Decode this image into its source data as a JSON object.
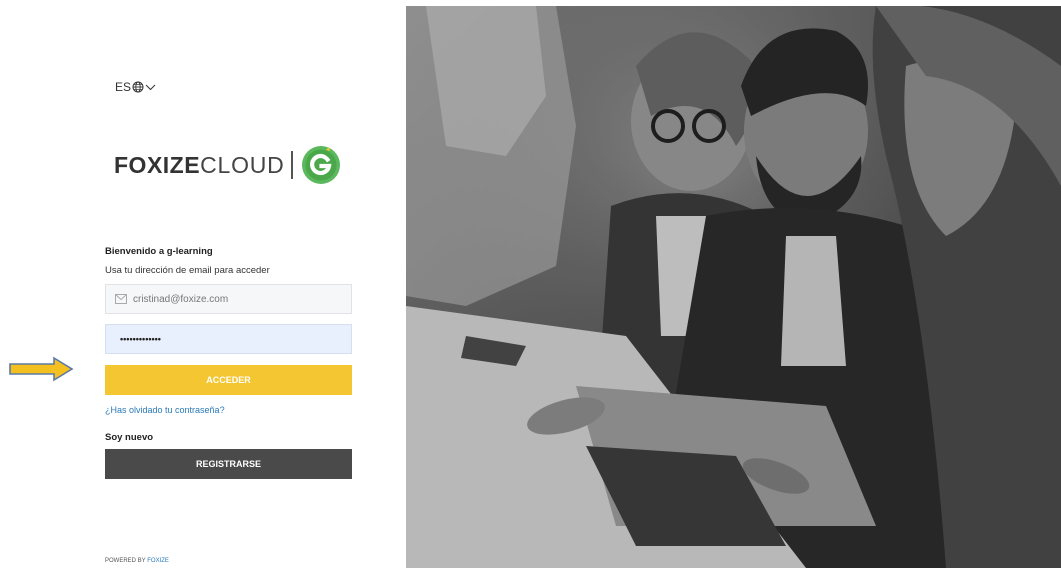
{
  "language": {
    "code": "ES"
  },
  "logo": {
    "brand_bold": "FOXIZE",
    "brand_light": "CLOUD"
  },
  "login": {
    "welcome": "Bienvenido a g-learning",
    "subtitle": "Usa tu dirección de email para acceder",
    "email_value": "cristinad@foxize.com",
    "password_mask": "•••••••••••••",
    "submit_label": "ACCEDER",
    "forgot_label": "¿Has olvidado tu contraseña?",
    "new_label": "Soy nuevo",
    "register_label": "REGISTRARSE"
  },
  "footer": {
    "powered_prefix": "POWERED BY",
    "powered_link": "FOXIZE"
  },
  "colors": {
    "accent": "#f4c732",
    "dark_button": "#4a4a4a",
    "link": "#2a7ab8",
    "logo_badge": "#5cb85c",
    "password_fill": "#e8f0fe"
  },
  "icons": [
    "globe-icon",
    "chevron-down-icon",
    "mail-icon",
    "g-learning-badge-icon",
    "arrow-right-icon"
  ]
}
